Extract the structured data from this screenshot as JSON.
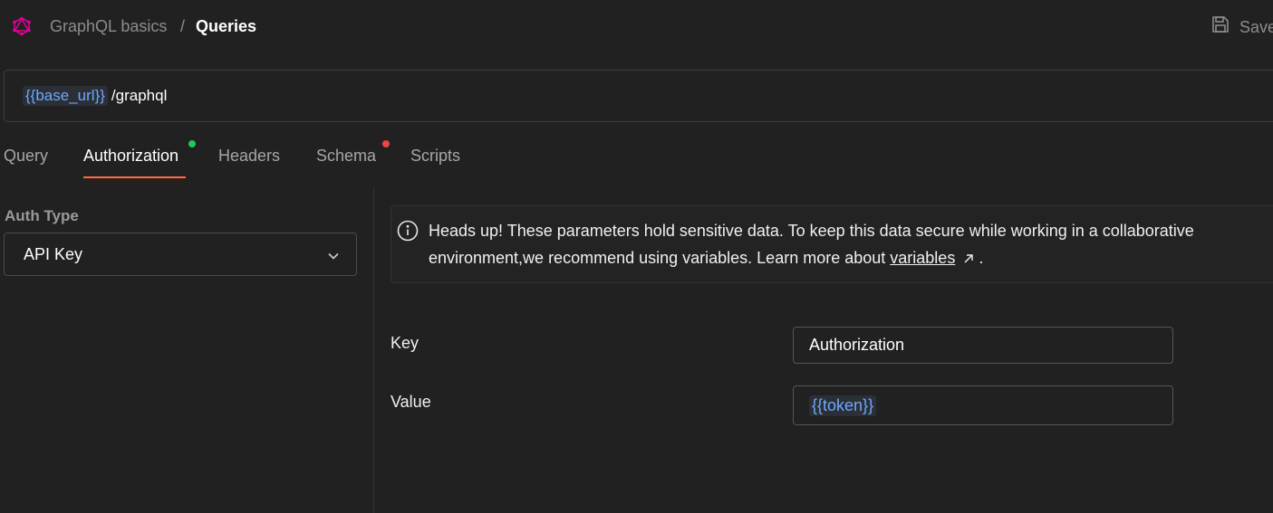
{
  "header": {
    "breadcrumb_parent": "GraphQL basics",
    "breadcrumb_separator": "/",
    "breadcrumb_current": "Queries",
    "save_label": "Save",
    "logo_icon": "graphql-logo-icon",
    "save_icon": "floppy-disk-icon"
  },
  "url_bar": {
    "variable": "{{base_url}}",
    "path": "/graphql"
  },
  "tabs": [
    {
      "label": "Query",
      "active": false
    },
    {
      "label": "Authorization",
      "active": true,
      "indicator": "#22c55e"
    },
    {
      "label": "Headers",
      "active": false
    },
    {
      "label": "Schema",
      "active": false,
      "indicator": "#ef4444"
    },
    {
      "label": "Scripts",
      "active": false
    }
  ],
  "auth": {
    "type_label": "Auth Type",
    "type_value": "API Key"
  },
  "banner": {
    "text_line1": "Heads up! These parameters hold sensitive data. To keep this data secure while working in a collaborative",
    "text_line2": "environment,we recommend using variables. Learn more about",
    "link": "variables",
    "trailing": "."
  },
  "fields": {
    "key_label": "Key",
    "key_value": "Authorization",
    "value_label": "Value",
    "value_value": "{{token}}"
  },
  "colors": {
    "accent": "#ff6c37",
    "variable": "#6fa8ff",
    "logo": "#e10098"
  }
}
